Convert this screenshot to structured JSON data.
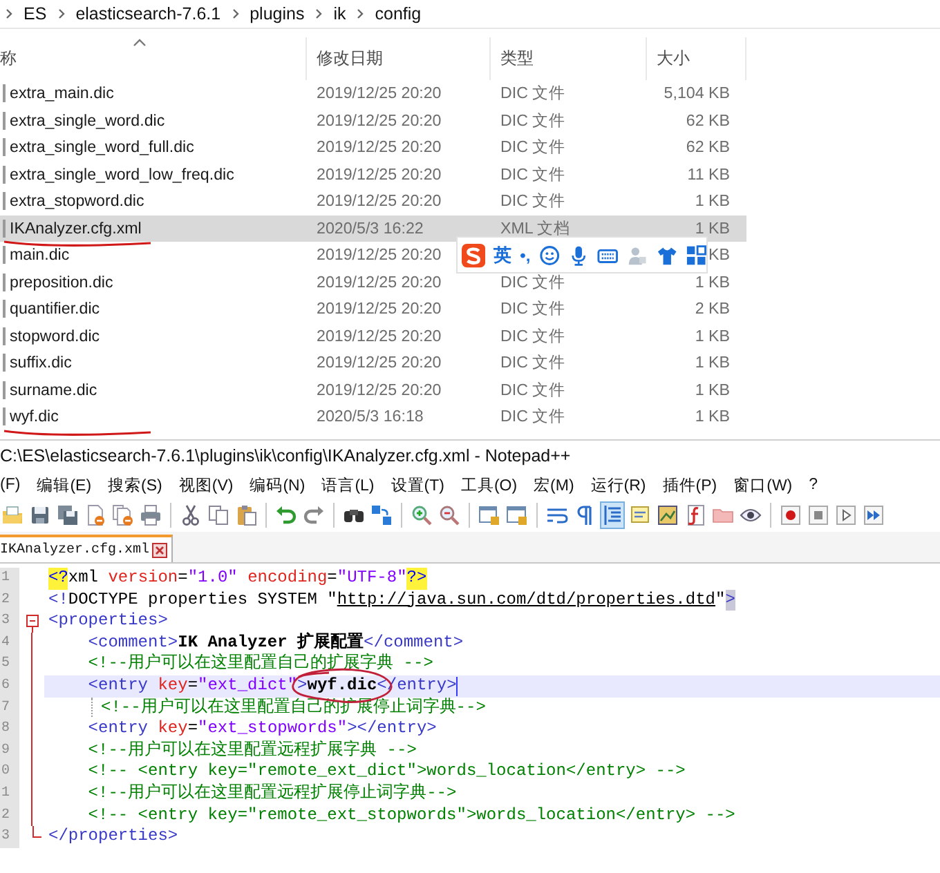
{
  "explorer": {
    "breadcrumb": [
      "ES",
      "elasticsearch-7.6.1",
      "plugins",
      "ik",
      "config"
    ],
    "columns": [
      {
        "label": "称",
        "sorted": true
      },
      {
        "label": "修改日期",
        "sorted": false
      },
      {
        "label": "类型",
        "sorted": false
      },
      {
        "label": "大小",
        "sorted": false
      }
    ],
    "rows": [
      {
        "name": "extra_main.dic",
        "date": "2019/12/25 20:20",
        "type": "DIC 文件",
        "size": "5,104 KB",
        "selected": false,
        "underlined": false
      },
      {
        "name": "extra_single_word.dic",
        "date": "2019/12/25 20:20",
        "type": "DIC 文件",
        "size": "62 KB",
        "selected": false,
        "underlined": false
      },
      {
        "name": "extra_single_word_full.dic",
        "date": "2019/12/25 20:20",
        "type": "DIC 文件",
        "size": "62 KB",
        "selected": false,
        "underlined": false
      },
      {
        "name": "extra_single_word_low_freq.dic",
        "date": "2019/12/25 20:20",
        "type": "DIC 文件",
        "size": "11 KB",
        "selected": false,
        "underlined": false
      },
      {
        "name": "extra_stopword.dic",
        "date": "2019/12/25 20:20",
        "type": "DIC 文件",
        "size": "1 KB",
        "selected": false,
        "underlined": false
      },
      {
        "name": "IKAnalyzer.cfg.xml",
        "date": "2020/5/3 16:22",
        "type": "XML 文档",
        "size": "1 KB",
        "selected": true,
        "underlined": true
      },
      {
        "name": "main.dic",
        "date": "2019/12/25 20:20",
        "size": "KB",
        "selected": false,
        "underlined": false
      },
      {
        "name": "preposition.dic",
        "date": "2019/12/25 20:20",
        "type": "DIC 文件",
        "size": "1 KB",
        "selected": false,
        "underlined": false
      },
      {
        "name": "quantifier.dic",
        "date": "2019/12/25 20:20",
        "type": "DIC 文件",
        "size": "2 KB",
        "selected": false,
        "underlined": false
      },
      {
        "name": "stopword.dic",
        "date": "2019/12/25 20:20",
        "type": "DIC 文件",
        "size": "1 KB",
        "selected": false,
        "underlined": false
      },
      {
        "name": "suffix.dic",
        "date": "2019/12/25 20:20",
        "type": "DIC 文件",
        "size": "1 KB",
        "selected": false,
        "underlined": false
      },
      {
        "name": "surname.dic",
        "date": "2019/12/25 20:20",
        "type": "DIC 文件",
        "size": "1 KB",
        "selected": false,
        "underlined": false
      },
      {
        "name": "wyf.dic",
        "date": "2020/5/3 16:18",
        "type": "DIC 文件",
        "size": "1 KB",
        "selected": false,
        "underlined": true
      }
    ]
  },
  "ime_toolbar": {
    "mode": "英",
    "punctuation": "•,"
  },
  "notepad": {
    "title": "C:\\ES\\elasticsearch-7.6.1\\plugins\\ik\\config\\IKAnalyzer.cfg.xml - Notepad++",
    "menu": [
      "(F)",
      "编辑(E)",
      "搜索(S)",
      "视图(V)",
      "编码(N)",
      "语言(L)",
      "设置(T)",
      "工具(O)",
      "宏(M)",
      "运行(R)",
      "插件(P)",
      "窗口(W)",
      "?"
    ],
    "toolbar": [
      [
        {
          "kind": "open",
          "selected": false
        },
        {
          "kind": "save",
          "selected": false
        },
        {
          "kind": "saveall",
          "selected": false
        },
        {
          "kind": "close",
          "selected": false
        },
        {
          "kind": "closeall",
          "selected": false
        },
        {
          "kind": "print",
          "selected": false
        }
      ],
      [
        {
          "kind": "cut",
          "selected": false
        },
        {
          "kind": "copy",
          "selected": false
        },
        {
          "kind": "paste",
          "selected": false
        }
      ],
      [
        {
          "kind": "undo",
          "selected": false
        },
        {
          "kind": "redo",
          "selected": false
        }
      ],
      [
        {
          "kind": "find",
          "selected": false
        },
        {
          "kind": "replace",
          "selected": false
        }
      ],
      [
        {
          "kind": "zoomin",
          "selected": false
        },
        {
          "kind": "zoomout",
          "selected": false
        }
      ],
      [
        {
          "kind": "syncv",
          "selected": false
        },
        {
          "kind": "synch",
          "selected": false
        }
      ],
      [
        {
          "kind": "wrap",
          "selected": false
        },
        {
          "kind": "pilcrow",
          "selected": false
        },
        {
          "kind": "indent",
          "selected": true
        },
        {
          "kind": "note",
          "selected": false
        },
        {
          "kind": "map",
          "selected": false
        },
        {
          "kind": "function",
          "selected": false
        },
        {
          "kind": "folder",
          "selected": false
        },
        {
          "kind": "eye",
          "selected": false
        }
      ],
      [
        {
          "kind": "record",
          "selected": false
        },
        {
          "kind": "stop",
          "selected": false
        },
        {
          "kind": "play",
          "selected": false
        },
        {
          "kind": "playmulti",
          "selected": false
        }
      ]
    ],
    "tabs": [
      {
        "label": "IKAnalyzer.cfg.xml",
        "selected": true
      }
    ],
    "lines": [
      {
        "number": "1",
        "current": false,
        "kind": "plain",
        "segments": [
          {
            "kind": "pi",
            "text": "<?"
          },
          {
            "kind": "plain",
            "text": "xml "
          },
          {
            "kind": "attr",
            "text": "version"
          },
          {
            "kind": "plain",
            "text": "="
          },
          {
            "kind": "value",
            "text": "\"1.0\" "
          },
          {
            "kind": "attr",
            "text": "encoding"
          },
          {
            "kind": "plain",
            "text": "="
          },
          {
            "kind": "value",
            "text": "\"UTF-8\""
          },
          {
            "kind": "pi",
            "text": "?>"
          }
        ]
      },
      {
        "number": "2",
        "current": false,
        "kind": "plain",
        "segments": [
          {
            "kind": "tag",
            "text": "<!"
          },
          {
            "kind": "plain",
            "text": "DOCTYPE properties SYSTEM \""
          },
          {
            "kind": "url",
            "text": "http://java.sun.com/dtd/properties.dtd"
          },
          {
            "kind": "plain",
            "text": "\""
          },
          {
            "kind": "tagbox",
            "text": ">"
          }
        ]
      },
      {
        "number": "3",
        "current": false,
        "kind": "fold-start",
        "segments": [
          {
            "kind": "tag",
            "text": "<properties>"
          }
        ]
      },
      {
        "number": "4",
        "current": false,
        "kind": "fold-body",
        "segments": [
          {
            "kind": "tag",
            "text": "    <comment>"
          },
          {
            "kind": "text",
            "text": "IK Analyzer 扩展配置"
          },
          {
            "kind": "tag",
            "text": "</comment>"
          }
        ]
      },
      {
        "number": "5",
        "current": false,
        "kind": "fold-body",
        "segments": [
          {
            "kind": "comment",
            "text": "    <!--用户可以在这里配置自己的扩展字典 -->"
          }
        ]
      },
      {
        "number": "6",
        "current": true,
        "kind": "fold-body",
        "segments": [
          {
            "kind": "tag",
            "text": "    <entry "
          },
          {
            "kind": "attr",
            "text": "key"
          },
          {
            "kind": "plain",
            "text": "="
          },
          {
            "kind": "value",
            "text": "\"ext_dict\""
          },
          {
            "kind": "tag",
            "text": ">"
          },
          {
            "kind": "circled",
            "text": "wyf.dic"
          },
          {
            "kind": "tag",
            "text": "</entry>"
          }
        ]
      },
      {
        "number": "7",
        "current": false,
        "kind": "fold-body",
        "guide": true,
        "segments": [
          {
            "kind": "comment",
            "text": "<!--用户可以在这里配置自己的扩展停止词字典-->"
          }
        ]
      },
      {
        "number": "8",
        "current": false,
        "kind": "fold-body",
        "segments": [
          {
            "kind": "tag",
            "text": "    <entry "
          },
          {
            "kind": "attr",
            "text": "key"
          },
          {
            "kind": "plain",
            "text": "="
          },
          {
            "kind": "value",
            "text": "\"ext_stopwords\""
          },
          {
            "kind": "tag",
            "text": "></entry>"
          }
        ]
      },
      {
        "number": "9",
        "current": false,
        "kind": "fold-body",
        "segments": [
          {
            "kind": "comment",
            "text": "    <!--用户可以在这里配置远程扩展字典 -->"
          }
        ]
      },
      {
        "number": "0",
        "current": false,
        "kind": "fold-body",
        "segments": [
          {
            "kind": "comment",
            "text": "    <!-- <entry key=\"remote_ext_dict\">words_location</entry> -->"
          }
        ]
      },
      {
        "number": "1",
        "current": false,
        "kind": "fold-body",
        "segments": [
          {
            "kind": "comment",
            "text": "    <!--用户可以在这里配置远程扩展停止词字典-->"
          }
        ]
      },
      {
        "number": "2",
        "current": false,
        "kind": "fold-body",
        "segments": [
          {
            "kind": "comment",
            "text": "    <!-- <entry key=\"remote_ext_stopwords\">words_location</entry> -->"
          }
        ]
      },
      {
        "number": "3",
        "current": false,
        "kind": "fold-end",
        "segments": [
          {
            "kind": "tag",
            "text": "</properties>"
          }
        ]
      }
    ]
  }
}
